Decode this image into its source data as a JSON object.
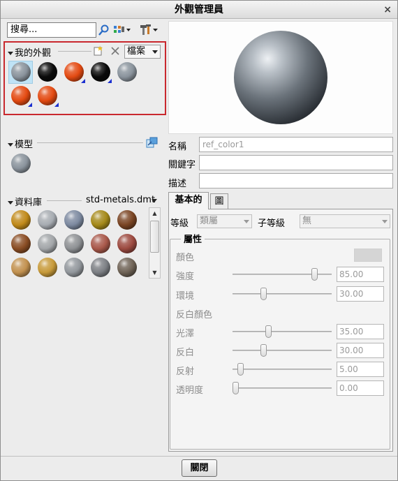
{
  "window": {
    "title": "外觀管理員"
  },
  "search": {
    "value": "搜尋..."
  },
  "my_appearances": {
    "label": "我的外觀",
    "file_menu": "檔案",
    "swatches": [
      {
        "name": "gray-sphere",
        "color": "#8a939c",
        "flagged": false,
        "selected": true
      },
      {
        "name": "black-sphere",
        "color": "#0a0a0a",
        "flagged": false
      },
      {
        "name": "orange-sphere",
        "color": "#e34a12",
        "flagged": true
      },
      {
        "name": "black-sphere",
        "color": "#0a0a0a",
        "flagged": true
      },
      {
        "name": "gray-sphere",
        "color": "#8a939c",
        "flagged": false
      },
      {
        "name": "orange-sphere",
        "color": "#e34a12",
        "flagged": true
      },
      {
        "name": "orange-sphere",
        "color": "#e34a12",
        "flagged": true
      }
    ]
  },
  "model": {
    "label": "模型",
    "swatches": [
      {
        "name": "gray-sphere",
        "color": "#8a939c"
      }
    ]
  },
  "library": {
    "label": "資料庫",
    "file": "std-metals.dmt",
    "swatches": [
      {
        "color": "#c08a1a"
      },
      {
        "color": "#a7acb2"
      },
      {
        "color": "#7d8aa0"
      },
      {
        "color": "#a58a1a"
      },
      {
        "color": "#7a4524"
      },
      {
        "color": "#8a4d24"
      },
      {
        "color": "#a3a6a9"
      },
      {
        "color": "#8e9194"
      },
      {
        "color": "#a8584a"
      },
      {
        "color": "#9c4a40"
      },
      {
        "color": "#c2914f"
      },
      {
        "color": "#c79a3a"
      },
      {
        "color": "#92979c"
      },
      {
        "color": "#7d8085"
      },
      {
        "color": "#6f6356"
      }
    ]
  },
  "fields": {
    "name_label": "名稱",
    "name_value": "ref_color1",
    "keywords_label": "關鍵字",
    "keywords_value": "",
    "description_label": "描述",
    "description_value": ""
  },
  "tabs": [
    {
      "label": "基本的"
    },
    {
      "label": "圖"
    }
  ],
  "class_row": {
    "class_label": "等級",
    "class_value": "類屬",
    "subclass_label": "子等級",
    "subclass_value": "無"
  },
  "properties": {
    "title": "屬性",
    "color_label": "顏色",
    "intensity_label": "強度",
    "intensity_value": "85.00",
    "intensity": 85,
    "ambient_label": "環境",
    "ambient_value": "30.00",
    "ambient": 30,
    "highlight_color_label": "反白顏色",
    "shininess_label": "光澤",
    "shininess_value": "35.00",
    "shininess": 35,
    "highlight_label": "反白",
    "highlight_value": "30.00",
    "highlight": 30,
    "reflection_label": "反射",
    "reflection_value": "5.00",
    "reflection": 5,
    "transparency_label": "透明度",
    "transparency_value": "0.00",
    "transparency": 0
  },
  "footer": {
    "close_label": "關閉"
  }
}
